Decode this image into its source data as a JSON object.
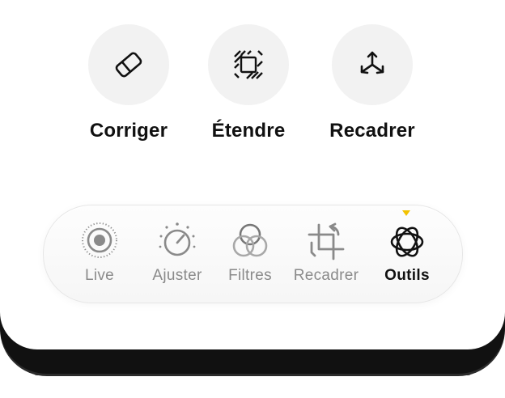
{
  "tools": [
    {
      "label": "Corriger",
      "icon": "eraser-icon"
    },
    {
      "label": "Étendre",
      "icon": "expand-frame-icon"
    },
    {
      "label": "Recadrer",
      "icon": "three-arrows-icon"
    }
  ],
  "toolbar": {
    "items": [
      {
        "label": "Live",
        "icon": "live-icon",
        "active": false
      },
      {
        "label": "Ajuster",
        "icon": "adjust-dial-icon",
        "active": false
      },
      {
        "label": "Filtres",
        "icon": "filters-icon",
        "active": false
      },
      {
        "label": "Recadrer",
        "icon": "crop-rotate-icon",
        "active": false
      },
      {
        "label": "Outils",
        "icon": "tools-flower-icon",
        "active": true
      }
    ]
  },
  "colors": {
    "accent_indicator": "#f2c200",
    "inactive_label": "#8a8a8a",
    "active_label": "#111111"
  }
}
